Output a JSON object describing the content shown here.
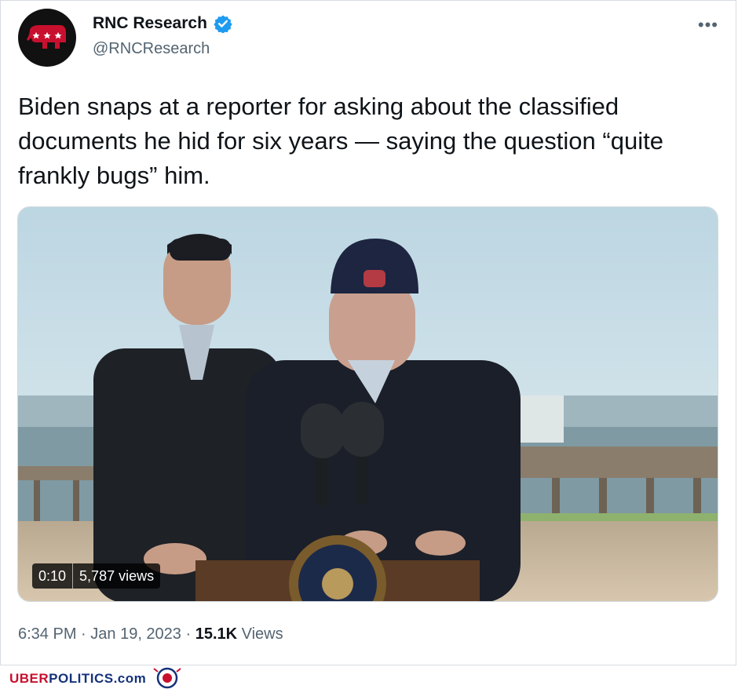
{
  "account": {
    "display_name": "RNC Research",
    "handle": "@RNCResearch",
    "avatar_icon": "gop-elephant-icon",
    "verified_icon": "verified-badge-icon",
    "more_icon": "more-dots-icon",
    "more_label": "•••"
  },
  "tweet": {
    "text": "Biden snaps at a reporter for asking about the classified documents he hid for six years — saying the question “quite frankly bugs” him."
  },
  "video": {
    "duration": "0:10",
    "views_badge": "5,787 views",
    "seal_text": "PRESIDENT OF THE UNITED"
  },
  "meta": {
    "time": "6:34 PM",
    "separator": " · ",
    "date": "Jan 19, 2023",
    "views_count": "15.1K",
    "views_label": " Views"
  },
  "watermark": {
    "part1": "UBER",
    "part2": "POLITICS",
    "part3": ".com"
  },
  "colors": {
    "accent": "#1d9bf0",
    "text": "#0f1419",
    "secondary": "#536471",
    "brand_red": "#c8102e",
    "brand_blue": "#15327a"
  }
}
